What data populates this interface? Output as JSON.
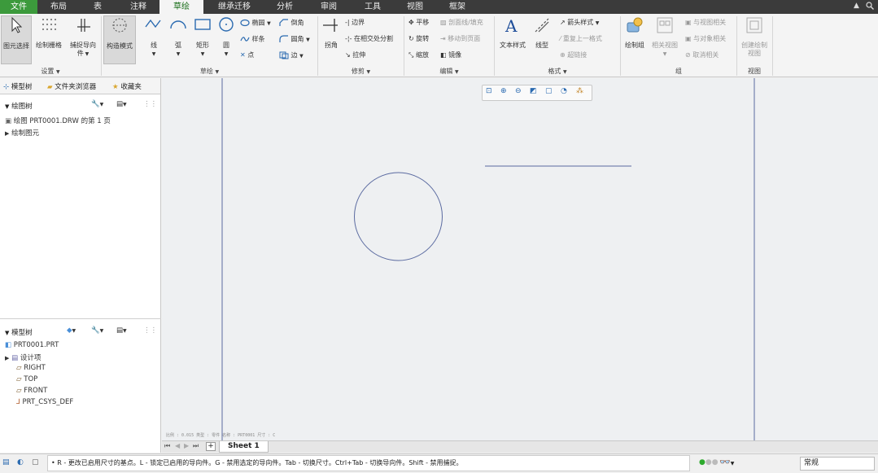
{
  "tabs": [
    {
      "label": "文件"
    },
    {
      "label": "布局"
    },
    {
      "label": "表"
    },
    {
      "label": "注释"
    },
    {
      "label": "草绘"
    },
    {
      "label": "继承迁移"
    },
    {
      "label": "分析"
    },
    {
      "label": "审阅"
    },
    {
      "label": "工具"
    },
    {
      "label": "视图"
    },
    {
      "label": "框架"
    }
  ],
  "ribbon": {
    "settings": {
      "select": "图元选择",
      "grid": "绘制栅格",
      "snap": "捕捉导向",
      "snap2": "件",
      "label": "设置"
    },
    "sketch": {
      "construct": "构造模式",
      "line": "线",
      "arc": "弧",
      "rect": "矩形",
      "circle": "圆",
      "ellipse": "椭圆",
      "spline": "样条",
      "point": "点",
      "chamfer": "倒角",
      "fillet": "圆角",
      "edge": "边",
      "label": "草绘"
    },
    "trim": {
      "corner": "拐角",
      "boundary": "边界",
      "divide": "在相交处分割",
      "stretch": "拉伸",
      "label": "修剪"
    },
    "edit": {
      "translate": "平移",
      "rotate": "旋转",
      "scale": "缩放",
      "hatch": "剖面线/填充",
      "movepage": "移动到页面",
      "mirror": "镜像",
      "label": "编辑"
    },
    "format": {
      "textstyle": "文本样式",
      "linestyle": "线型",
      "arrow": "箭头样式",
      "repeat": "重复上一格式",
      "hyperlink": "超链接",
      "label": "格式"
    },
    "group": {
      "draw": "绘制组",
      "related": "相关视图",
      "viewrel": "与视图相关",
      "objrel": "与对象相关",
      "cancelrel": "取消相关",
      "label": "组"
    },
    "view": {
      "create": "创建绘制",
      "create2": "视图",
      "label": "视图"
    }
  },
  "left_panel": {
    "tabs": [
      "模型树",
      "文件夹浏览器",
      "收藏夹"
    ],
    "drawing_tree": {
      "header": "绘图树",
      "items": [
        "绘图 PRT0001.DRW 的第 1 页",
        "绘制图元"
      ]
    },
    "model_tree": {
      "header": "模型树",
      "root": "PRT0001.PRT",
      "items": [
        "设计项",
        "RIGHT",
        "TOP",
        "FRONT",
        "PRT_CSYS_DEF"
      ]
    }
  },
  "sheet_tab": "Sheet 1",
  "canvas_footer": "比例 : 0.015    类型 : 零件    名称 : PRT0001    尺寸 : C",
  "status": {
    "message": "• R - 更改已启用尺寸的基点。L - 锁定已启用的导向件。G - 禁用选定的导向件。Tab - 切换尺寸。Ctrl+Tab - 切换导向件。Shift - 禁用捕捉。",
    "filter": "常规"
  },
  "colors": {
    "file_tab": "#3c9a3c",
    "active_tab_text": "#1a6e1a",
    "sketch_line": "#5a6aa0"
  }
}
